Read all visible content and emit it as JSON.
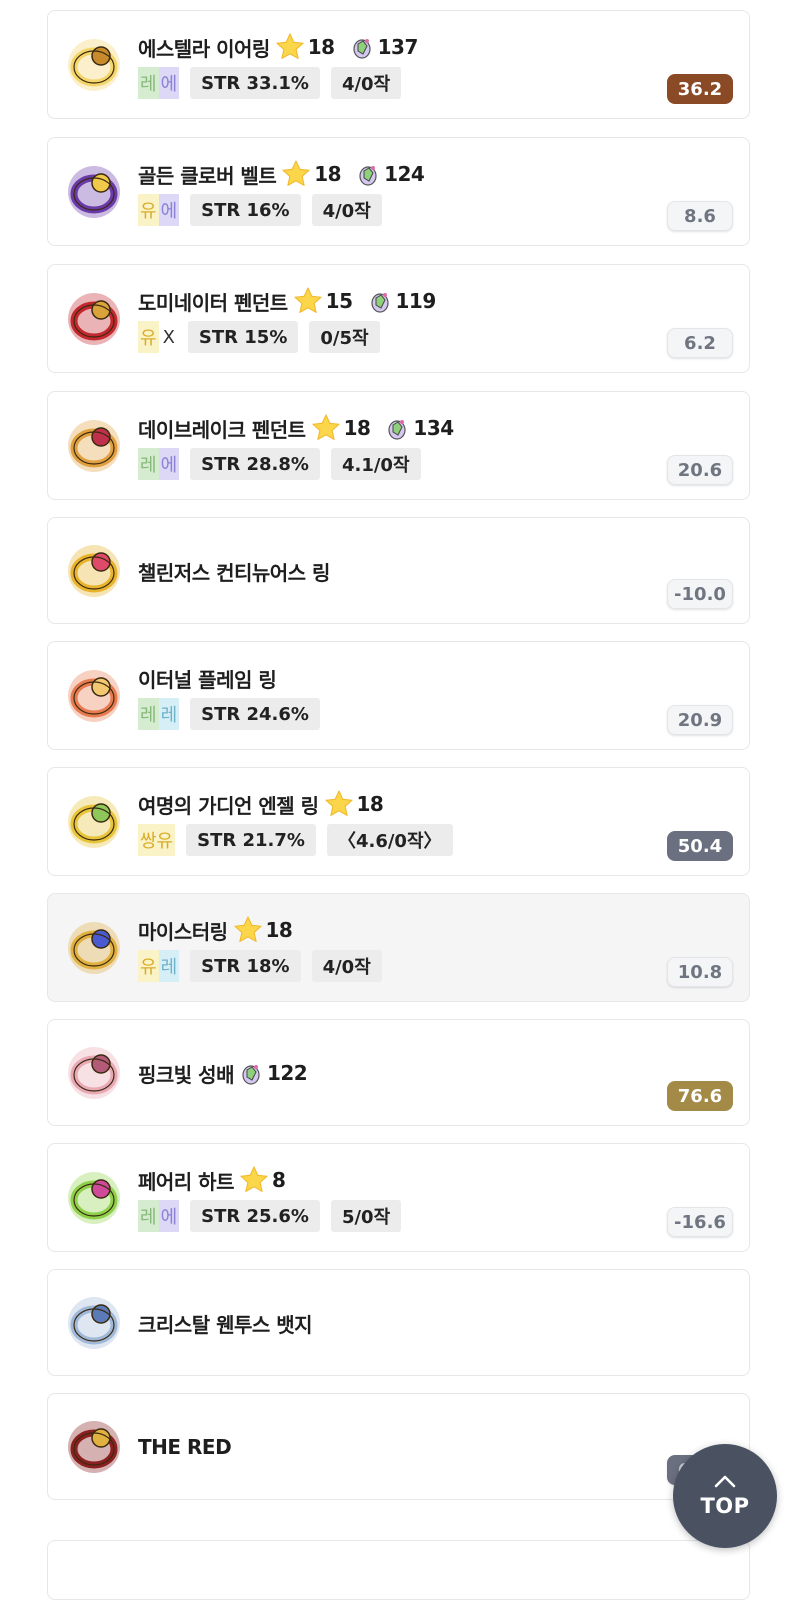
{
  "items": [
    {
      "name": "에스텔라 이어링",
      "star": "18",
      "gem": "137",
      "potential": [
        {
          "t": "레",
          "c": "#d5ecd0",
          "f": "#86b87a"
        },
        {
          "t": "에",
          "c": "#dcd8f6",
          "f": "#8a80d6"
        }
      ],
      "stat": "STR 33.1%",
      "scroll": "4/0작",
      "score": "36.2",
      "score_color": "#8a4a25",
      "score_style": "filled"
    },
    {
      "name": "골든 클로버 벨트",
      "star": "18",
      "gem": "124",
      "potential": [
        {
          "t": "유",
          "c": "#fbf3c8",
          "f": "#d8ad2a"
        },
        {
          "t": "에",
          "c": "#dcd8f6",
          "f": "#8a80d6"
        }
      ],
      "stat": "STR 16%",
      "scroll": "4/0작",
      "score": "8.6",
      "score_style": "plain"
    },
    {
      "name": "도미네이터 펜던트",
      "star": "15",
      "gem": "119",
      "potential": [
        {
          "t": "유",
          "c": "#fbf3c8",
          "f": "#d8ad2a"
        }
      ],
      "potential_extra": "X",
      "stat": "STR 15%",
      "scroll": "0/5작",
      "score": "6.2",
      "score_style": "plain"
    },
    {
      "name": "데이브레이크 펜던트",
      "star": "18",
      "gem": "134",
      "potential": [
        {
          "t": "레",
          "c": "#d5ecd0",
          "f": "#86b87a"
        },
        {
          "t": "에",
          "c": "#dcd8f6",
          "f": "#8a80d6"
        }
      ],
      "stat": "STR 28.8%",
      "scroll": "4.1/0작",
      "score": "20.6",
      "score_style": "plain"
    },
    {
      "name": "챌린저스 컨티뉴어스 링",
      "score": "-10.0",
      "score_style": "plain"
    },
    {
      "name": "이터널 플레임 링",
      "potential": [
        {
          "t": "레",
          "c": "#d5ecd0",
          "f": "#86b87a"
        },
        {
          "t": "레",
          "c": "#d6eef6",
          "f": "#6fb3c9"
        }
      ],
      "stat": "STR 24.6%",
      "score": "20.9",
      "score_style": "plain"
    },
    {
      "name": "여명의 가디언 엔젤 링",
      "star": "18",
      "potential": [
        {
          "t": "쌍유",
          "c": "#fbf3c8",
          "f": "#d8ad2a"
        }
      ],
      "stat": "STR 21.7%",
      "scroll": "〈4.6/0작〉",
      "score": "50.4",
      "score_color": "#6b7080",
      "score_style": "filled"
    },
    {
      "name": "마이스터링",
      "star": "18",
      "potential": [
        {
          "t": "유",
          "c": "#fbf3c8",
          "f": "#d8ad2a"
        },
        {
          "t": "레",
          "c": "#d6eef6",
          "f": "#6fb3c9"
        }
      ],
      "stat": "STR 18%",
      "scroll": "4/0작",
      "score": "10.8",
      "score_style": "plain",
      "highlight": true
    },
    {
      "name": "핑크빛 성배",
      "gem": "122",
      "score": "76.6",
      "score_color": "#a38a46",
      "score_style": "filled"
    },
    {
      "name": "페어리 하트",
      "star": "8",
      "potential": [
        {
          "t": "레",
          "c": "#d5ecd0",
          "f": "#86b87a"
        },
        {
          "t": "에",
          "c": "#dcd8f6",
          "f": "#8a80d6"
        }
      ],
      "stat": "STR 25.6%",
      "scroll": "5/0작",
      "score": "-16.6",
      "score_style": "plain"
    },
    {
      "name": "크리스탈 웬투스 뱃지"
    },
    {
      "name": "THE RED",
      "score": "60.1",
      "score_style": "hidden"
    }
  ],
  "top_button": {
    "label": "TOP",
    "icon": "chevron-up-icon"
  },
  "icons": [
    "earring-icon",
    "belt-icon",
    "pendant-icon",
    "pendant-icon",
    "ring-icon",
    "ring-icon",
    "ring-icon",
    "ring-icon",
    "chalice-icon",
    "heart-icon",
    "badge-icon",
    "medal-icon"
  ]
}
